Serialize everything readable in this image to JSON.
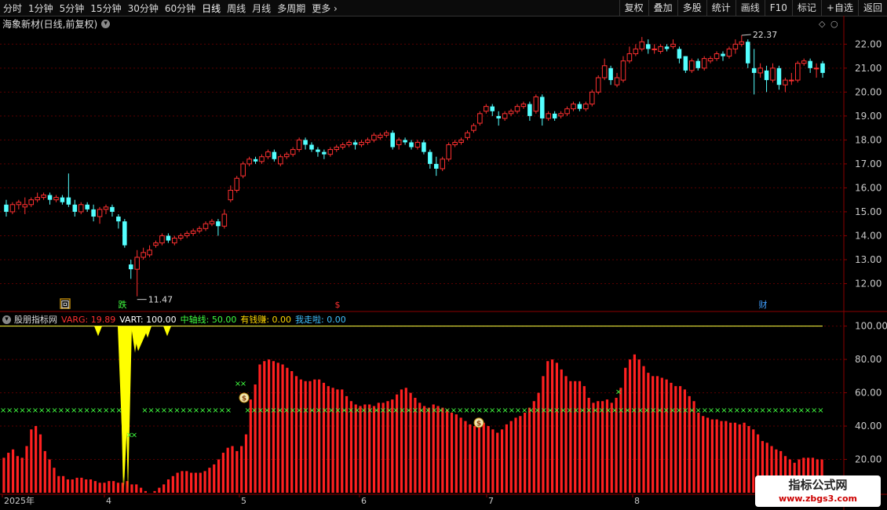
{
  "toolbar": {
    "periods": [
      "分时",
      "1分钟",
      "5分钟",
      "15分钟",
      "30分钟",
      "60分钟",
      "日线",
      "周线",
      "月线",
      "多周期",
      "更多"
    ],
    "active_period": "日线",
    "right_buttons": [
      "复权",
      "叠加",
      "多股",
      "统计",
      "画线",
      "F10",
      "标记",
      "+自选",
      "返回"
    ]
  },
  "main_chart": {
    "title": "海象新材(日线,前复权)",
    "high_label": "22.37",
    "low_label": "11.47",
    "markers": [
      "回",
      "跌",
      "$",
      "财"
    ],
    "y_ticks": [
      "22.00",
      "21.00",
      "20.00",
      "19.00",
      "18.00",
      "17.00",
      "16.00",
      "15.00",
      "14.00",
      "13.00",
      "12.00"
    ]
  },
  "indicator": {
    "name": "股朋指标网",
    "items": [
      {
        "label": "VARG: 19.89",
        "color": "#ff3030"
      },
      {
        "label": "VART: 100.00",
        "color": "#ffffff"
      },
      {
        "label": "中轴线: 50.00",
        "color": "#40ff40"
      },
      {
        "label": "有钱赚: 0.00",
        "color": "#ffd700"
      },
      {
        "label": "我走啦: 0.00",
        "color": "#40c0ff"
      }
    ],
    "y_ticks": [
      "100.00",
      "80.00",
      "60.00",
      "40.00",
      "20.00"
    ]
  },
  "x_axis": {
    "labels": [
      "2025年",
      "4",
      "5",
      "6",
      "7",
      "8"
    ]
  },
  "watermark": {
    "line1": "指标公式网",
    "line2": "www.zbgs3.com"
  },
  "colors": {
    "up": "#ff3030",
    "down": "#54ffff",
    "grid": "#5a0000",
    "axis": "#8b0000"
  },
  "chart_data": {
    "type": "candlestick",
    "candles": [
      [
        15.3,
        15.0,
        15.5,
        14.8
      ],
      [
        15.0,
        15.3,
        15.4,
        14.9
      ],
      [
        15.3,
        15.4,
        15.5,
        15.1
      ],
      [
        15.2,
        15.3,
        15.6,
        14.9
      ],
      [
        15.3,
        15.5,
        15.6,
        15.2
      ],
      [
        15.5,
        15.6,
        15.8,
        15.4
      ],
      [
        15.6,
        15.7,
        15.8,
        15.5
      ],
      [
        15.7,
        15.5,
        15.8,
        15.3
      ],
      [
        15.5,
        15.6,
        15.7,
        15.4
      ],
      [
        15.6,
        15.4,
        15.7,
        15.3
      ],
      [
        15.6,
        15.3,
        16.6,
        15.2
      ],
      [
        15.3,
        15.0,
        15.5,
        14.8
      ],
      [
        15.0,
        15.3,
        15.4,
        14.9
      ],
      [
        15.3,
        15.1,
        15.4,
        15.0
      ],
      [
        15.1,
        14.8,
        15.3,
        14.6
      ],
      [
        14.8,
        15.1,
        15.2,
        14.5
      ],
      [
        15.1,
        15.2,
        15.3,
        14.9
      ],
      [
        15.2,
        15.0,
        15.3,
        14.8
      ],
      [
        14.8,
        14.6,
        14.9,
        14.3
      ],
      [
        14.6,
        13.6,
        14.7,
        13.5
      ],
      [
        12.8,
        12.6,
        13.0,
        12.2
      ],
      [
        12.6,
        13.1,
        13.4,
        11.47
      ],
      [
        13.1,
        13.3,
        13.5,
        13.0
      ],
      [
        13.2,
        13.4,
        13.6,
        13.1
      ],
      [
        13.6,
        13.7,
        13.8,
        13.5
      ],
      [
        13.7,
        14.0,
        14.1,
        13.6
      ],
      [
        14.0,
        13.8,
        14.1,
        13.7
      ],
      [
        13.7,
        13.9,
        14.0,
        13.6
      ],
      [
        13.9,
        14.0,
        14.1,
        13.8
      ],
      [
        14.0,
        14.1,
        14.2,
        13.9
      ],
      [
        14.1,
        14.2,
        14.3,
        14.0
      ],
      [
        14.2,
        14.3,
        14.4,
        14.1
      ],
      [
        14.3,
        14.5,
        14.6,
        14.2
      ],
      [
        14.5,
        14.6,
        14.7,
        14.4
      ],
      [
        14.6,
        14.4,
        14.7,
        14.0
      ],
      [
        14.4,
        14.9,
        15.1,
        14.3
      ],
      [
        15.5,
        15.9,
        16.1,
        15.4
      ],
      [
        15.9,
        16.4,
        16.5,
        15.8
      ],
      [
        16.5,
        17.0,
        17.1,
        16.4
      ],
      [
        17.0,
        17.2,
        17.3,
        16.9
      ],
      [
        17.2,
        17.1,
        17.3,
        17.0
      ],
      [
        17.1,
        17.3,
        17.4,
        17.0
      ],
      [
        17.3,
        17.5,
        17.6,
        17.2
      ],
      [
        17.5,
        17.2,
        17.6,
        17.1
      ],
      [
        17.0,
        17.3,
        17.4,
        16.9
      ],
      [
        17.3,
        17.4,
        17.5,
        17.2
      ],
      [
        17.4,
        17.6,
        17.7,
        17.3
      ],
      [
        17.6,
        18.0,
        18.1,
        17.5
      ],
      [
        18.0,
        17.8,
        18.1,
        17.6
      ],
      [
        17.8,
        17.6,
        17.9,
        17.5
      ],
      [
        17.6,
        17.5,
        17.7,
        17.3
      ],
      [
        17.5,
        17.4,
        17.6,
        17.2
      ],
      [
        17.4,
        17.6,
        17.7,
        17.3
      ],
      [
        17.6,
        17.7,
        17.8,
        17.5
      ],
      [
        17.7,
        17.8,
        17.9,
        17.6
      ],
      [
        17.8,
        17.9,
        18.0,
        17.7
      ],
      [
        17.9,
        17.8,
        18.0,
        17.6
      ],
      [
        17.8,
        17.9,
        18.0,
        17.7
      ],
      [
        17.9,
        18.0,
        18.1,
        17.8
      ],
      [
        18.0,
        18.2,
        18.3,
        17.9
      ],
      [
        18.1,
        18.2,
        18.3,
        18.0
      ],
      [
        18.2,
        18.3,
        18.4,
        18.1
      ],
      [
        18.3,
        17.7,
        18.4,
        17.6
      ],
      [
        17.8,
        18.0,
        18.1,
        17.6
      ],
      [
        18.0,
        17.9,
        18.1,
        17.8
      ],
      [
        17.9,
        17.7,
        18.0,
        17.6
      ],
      [
        17.7,
        17.9,
        18.0,
        17.6
      ],
      [
        17.9,
        17.5,
        18.0,
        17.4
      ],
      [
        17.5,
        17.0,
        17.6,
        16.8
      ],
      [
        17.0,
        16.8,
        17.3,
        16.5
      ],
      [
        16.8,
        17.2,
        17.3,
        16.7
      ],
      [
        17.2,
        17.8,
        17.9,
        17.1
      ],
      [
        17.8,
        17.9,
        18.0,
        17.7
      ],
      [
        17.9,
        18.0,
        18.1,
        17.8
      ],
      [
        18.1,
        18.3,
        18.4,
        18.0
      ],
      [
        18.4,
        18.6,
        18.7,
        18.3
      ],
      [
        18.7,
        19.1,
        19.2,
        18.6
      ],
      [
        19.2,
        19.4,
        19.5,
        19.1
      ],
      [
        19.4,
        19.2,
        19.5,
        19.0
      ],
      [
        19.0,
        18.9,
        19.2,
        18.6
      ],
      [
        18.9,
        19.1,
        19.2,
        18.8
      ],
      [
        19.1,
        19.2,
        19.3,
        19.0
      ],
      [
        19.2,
        19.4,
        19.5,
        19.1
      ],
      [
        19.4,
        19.5,
        19.6,
        19.3
      ],
      [
        19.5,
        19.0,
        19.6,
        18.8
      ],
      [
        19.2,
        19.8,
        19.9,
        19.1
      ],
      [
        19.8,
        18.9,
        19.9,
        18.6
      ],
      [
        18.9,
        19.1,
        19.2,
        18.8
      ],
      [
        19.1,
        18.9,
        19.2,
        18.8
      ],
      [
        19.0,
        19.1,
        19.2,
        18.9
      ],
      [
        19.1,
        19.3,
        19.4,
        19.0
      ],
      [
        19.3,
        19.5,
        19.6,
        19.2
      ],
      [
        19.5,
        19.3,
        19.6,
        19.2
      ],
      [
        19.3,
        19.5,
        19.6,
        19.2
      ],
      [
        19.5,
        20.0,
        20.1,
        19.4
      ],
      [
        20.0,
        20.6,
        20.7,
        19.9
      ],
      [
        20.6,
        21.1,
        21.4,
        20.5
      ],
      [
        21.0,
        20.5,
        21.1,
        20.3
      ],
      [
        20.3,
        20.6,
        20.8,
        20.2
      ],
      [
        20.5,
        21.3,
        21.5,
        20.4
      ],
      [
        21.3,
        21.6,
        21.9,
        21.2
      ],
      [
        21.6,
        21.8,
        22.0,
        21.5
      ],
      [
        21.8,
        22.1,
        22.3,
        21.7
      ],
      [
        22.0,
        21.8,
        22.2,
        21.6
      ],
      [
        21.8,
        21.8,
        22.0,
        21.6
      ],
      [
        21.7,
        21.9,
        22.0,
        21.6
      ],
      [
        21.9,
        21.8,
        22.0,
        21.7
      ],
      [
        21.9,
        22.0,
        22.2,
        21.8
      ],
      [
        21.8,
        21.4,
        21.9,
        21.2
      ],
      [
        21.5,
        20.9,
        21.5,
        20.8
      ],
      [
        20.9,
        21.3,
        21.4,
        20.8
      ],
      [
        21.3,
        21.0,
        21.4,
        20.9
      ],
      [
        21.0,
        21.4,
        21.5,
        20.9
      ],
      [
        21.3,
        21.4,
        21.5,
        21.2
      ],
      [
        21.4,
        21.6,
        21.7,
        21.3
      ],
      [
        21.6,
        21.5,
        21.7,
        21.3
      ],
      [
        21.5,
        21.8,
        21.9,
        21.4
      ],
      [
        21.8,
        22.0,
        22.2,
        21.6
      ],
      [
        22.0,
        22.1,
        22.37,
        21.9
      ],
      [
        22.1,
        21.2,
        22.2,
        21.0
      ],
      [
        21.0,
        20.8,
        21.8,
        19.9
      ],
      [
        20.8,
        21.0,
        21.2,
        20.6
      ],
      [
        20.9,
        20.5,
        21.1,
        20.0
      ],
      [
        20.5,
        21.0,
        21.2,
        20.4
      ],
      [
        21.0,
        20.3,
        21.1,
        20.1
      ],
      [
        20.3,
        20.5,
        20.6,
        20.0
      ],
      [
        20.5,
        20.5,
        20.8,
        20.3
      ],
      [
        20.5,
        21.2,
        21.3,
        20.4
      ],
      [
        21.2,
        21.3,
        21.4,
        21.1
      ],
      [
        21.3,
        21.0,
        21.4,
        20.8
      ],
      [
        21.0,
        21.0,
        21.2,
        20.6
      ],
      [
        21.2,
        20.8,
        21.3,
        20.6
      ]
    ],
    "indicator_bars": [
      21,
      24,
      26,
      22,
      21,
      28,
      38,
      40,
      35,
      25,
      20,
      15,
      10,
      10,
      8,
      8,
      9,
      9,
      8,
      8,
      7,
      6,
      6,
      7,
      7,
      6,
      6,
      7,
      5,
      5,
      3,
      1,
      0,
      1,
      3,
      5,
      8,
      10,
      12,
      13,
      13,
      12,
      12,
      12,
      13,
      15,
      17,
      20,
      24,
      27,
      28,
      25,
      28,
      35,
      56,
      65,
      77,
      79,
      80,
      79,
      78,
      77,
      75,
      73,
      70,
      68,
      67,
      67,
      68,
      68,
      66,
      64,
      63,
      62,
      62,
      58,
      55,
      53,
      52,
      53,
      53,
      52,
      54,
      54,
      55,
      56,
      59,
      62,
      63,
      60,
      57,
      54,
      52,
      51,
      53,
      52,
      51,
      50,
      48,
      47,
      45,
      43,
      41,
      40,
      41,
      42,
      40,
      38,
      36,
      38,
      41,
      43,
      45,
      46,
      48,
      51,
      55,
      60,
      70,
      79,
      80,
      78,
      74,
      70,
      67,
      67,
      67,
      64,
      57,
      54,
      55,
      55,
      56,
      54,
      57,
      63,
      75,
      80,
      83,
      80,
      76,
      72,
      70,
      70,
      69,
      68,
      66,
      64,
      64,
      62,
      58,
      55,
      48,
      46,
      45,
      44,
      44,
      43,
      43,
      42,
      42,
      41,
      42,
      40,
      38,
      35,
      31,
      30,
      28,
      26,
      25,
      22,
      20,
      18,
      20,
      21,
      21,
      21,
      20,
      20
    ],
    "middle_line": 50,
    "vart_line": 100,
    "ylim_price": [
      11.0,
      22.6
    ],
    "ylim_indicator": [
      0,
      105
    ]
  }
}
